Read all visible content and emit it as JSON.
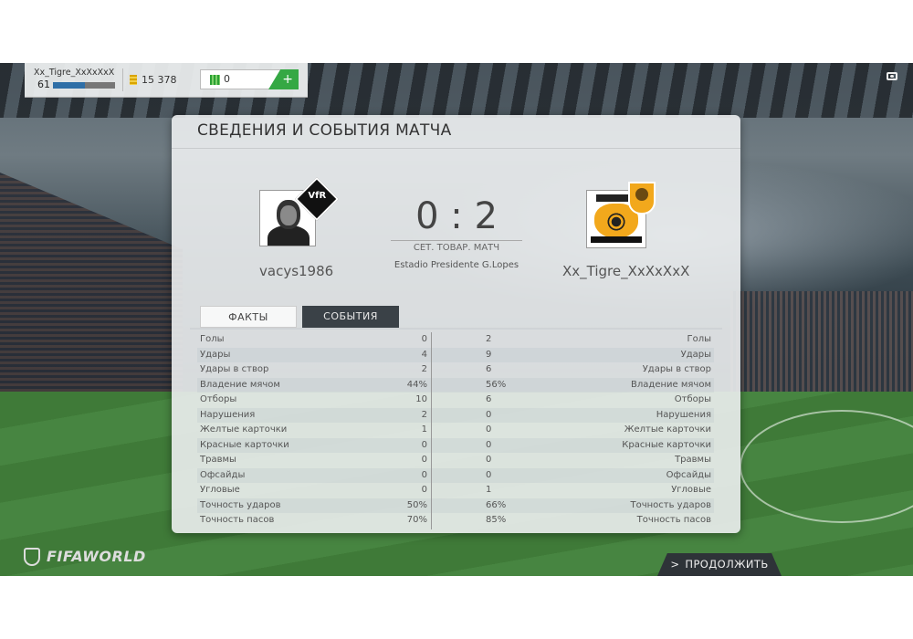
{
  "hud": {
    "player_name": "Xx_Tigre_XxXxXxX",
    "level": "61",
    "level_progress": 0.52,
    "coins": "15 378",
    "fifa_points": "0",
    "add_label": "+"
  },
  "panel": {
    "title": "СВЕДЕНИЯ И СОБЫТИЯ МАТЧА",
    "home_team": "vacys1986",
    "away_team": "Xx_Tigre_XxXxXxX",
    "score": "0 : 2",
    "match_type": "СЕТ. ТОВАР. МАТЧ",
    "stadium": "Estadio Presidente G.Lopes",
    "home_crest_text": "VfR",
    "tabs": [
      {
        "label": "ФАКТЫ",
        "active": true
      },
      {
        "label": "СОБЫТИЯ",
        "active": false
      }
    ]
  },
  "stats": [
    {
      "label": "Голы",
      "home": "0",
      "away": "2"
    },
    {
      "label": "Удары",
      "home": "4",
      "away": "9"
    },
    {
      "label": "Удары в створ",
      "home": "2",
      "away": "6"
    },
    {
      "label": "Владение мячом",
      "home": "44%",
      "away": "56%"
    },
    {
      "label": "Отборы",
      "home": "10",
      "away": "6"
    },
    {
      "label": "Нарушения",
      "home": "2",
      "away": "0"
    },
    {
      "label": "Желтые карточки",
      "home": "1",
      "away": "0"
    },
    {
      "label": "Красные карточки",
      "home": "0",
      "away": "0"
    },
    {
      "label": "Травмы",
      "home": "0",
      "away": "0"
    },
    {
      "label": "Офсайды",
      "home": "0",
      "away": "0"
    },
    {
      "label": "Угловые",
      "home": "0",
      "away": "1"
    },
    {
      "label": "Точность ударов",
      "home": "50%",
      "away": "66%"
    },
    {
      "label": "Точность пасов",
      "home": "70%",
      "away": "85%"
    }
  ],
  "footer": {
    "logo_text": "FIFAWORLD",
    "continue_label": "ПРОДОЛЖИТЬ",
    "continue_icon": ">"
  },
  "icons": {
    "coin": "coin-icon",
    "fifa_points": "fifa-points-icon",
    "camera": "camera-icon"
  },
  "colors": {
    "accent_green": "#35a844",
    "tab_dark": "#3a4147",
    "level_bar": "#2f6fa7"
  }
}
